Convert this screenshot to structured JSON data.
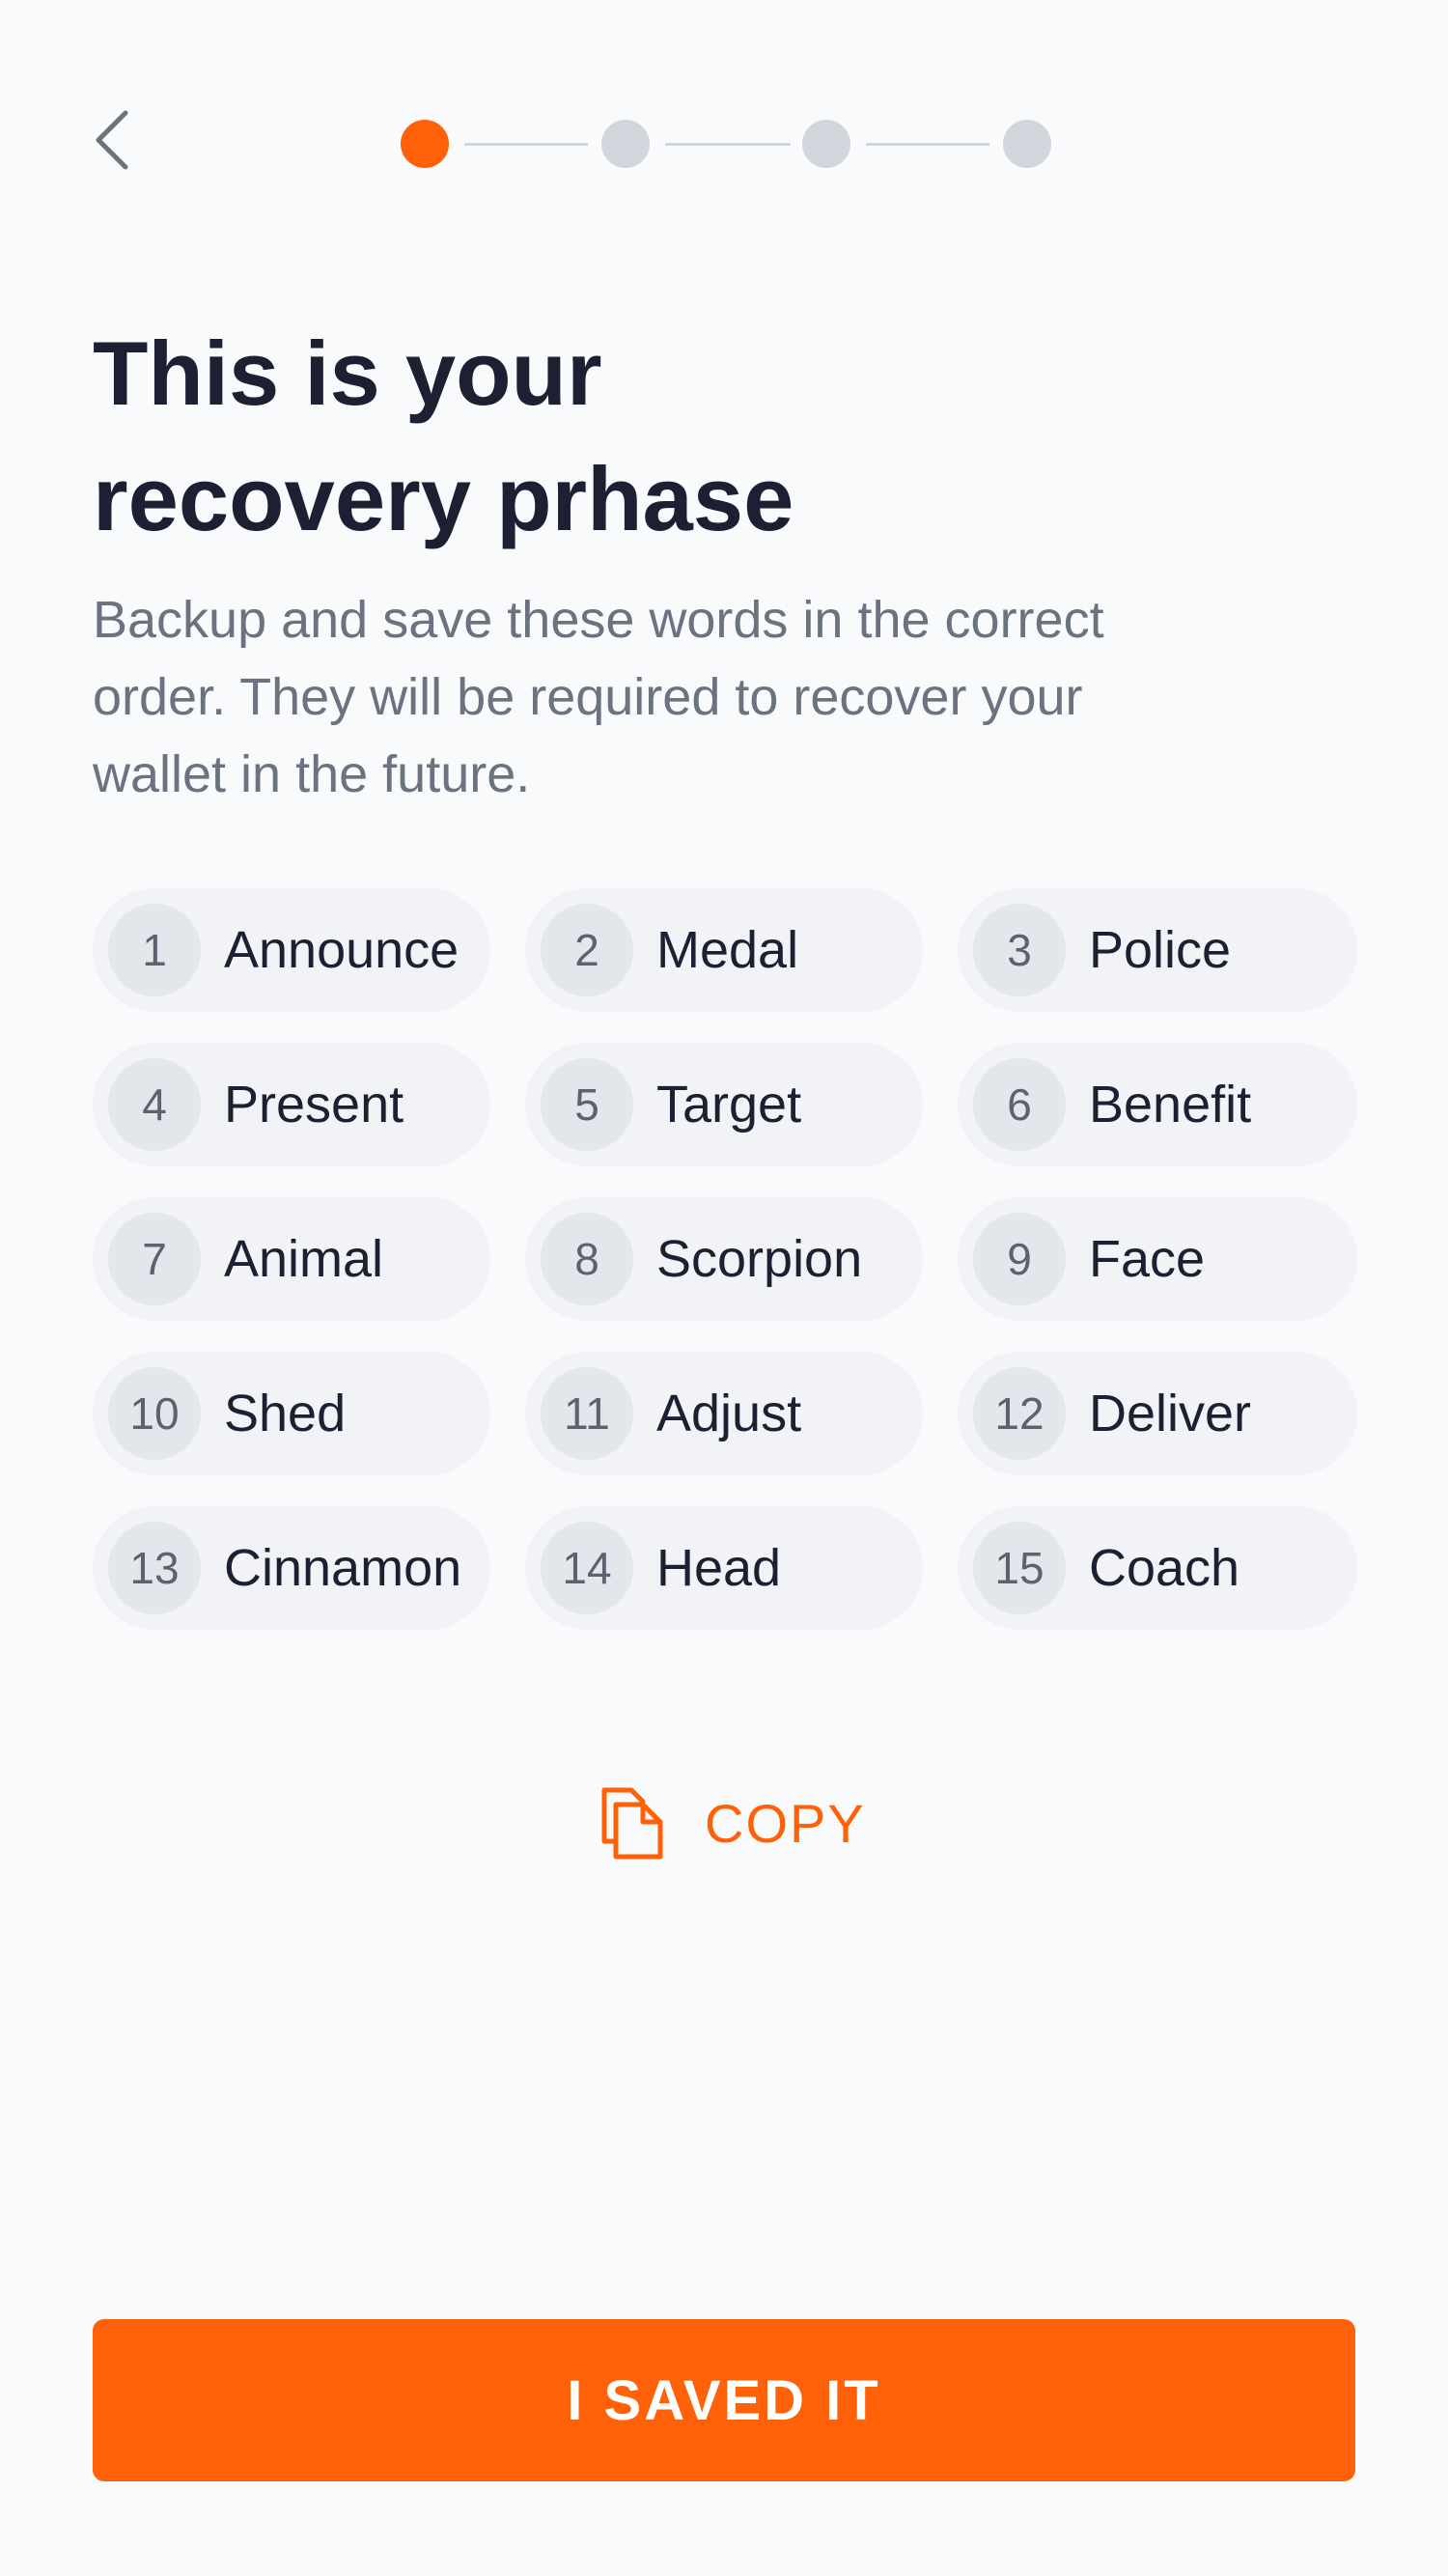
{
  "header": {
    "back_icon": "chevron-left-icon",
    "steps": [
      {
        "state": "active"
      },
      {
        "state": "inactive"
      },
      {
        "state": "inactive"
      },
      {
        "state": "inactive"
      }
    ]
  },
  "title_lines": [
    "This is your",
    "recovery prhase"
  ],
  "subtitle_lines": [
    "Backup and save these words in the correct",
    "order. They will be required to recover your",
    "wallet in the future."
  ],
  "words": [
    {
      "n": "1",
      "w": "Announce"
    },
    {
      "n": "2",
      "w": "Medal"
    },
    {
      "n": "3",
      "w": "Police"
    },
    {
      "n": "4",
      "w": "Present"
    },
    {
      "n": "5",
      "w": "Target"
    },
    {
      "n": "6",
      "w": "Benefit"
    },
    {
      "n": "7",
      "w": "Animal"
    },
    {
      "n": "8",
      "w": "Scorpion"
    },
    {
      "n": "9",
      "w": "Face"
    },
    {
      "n": "10",
      "w": "Shed"
    },
    {
      "n": "11",
      "w": "Adjust"
    },
    {
      "n": "12",
      "w": "Deliver"
    },
    {
      "n": "13",
      "w": "Cinnamon"
    },
    {
      "n": "14",
      "w": "Head"
    },
    {
      "n": "15",
      "w": "Coach"
    }
  ],
  "copy": {
    "label": "COPY",
    "icon": "copy-icon"
  },
  "primary_button": {
    "label": "I SAVED IT"
  },
  "colors": {
    "accent": "#ff6108",
    "title": "#1d1f33",
    "muted": "#6b7280",
    "chip_bg": "#f1f3f6",
    "step_inactive": "#d2d6dc"
  }
}
